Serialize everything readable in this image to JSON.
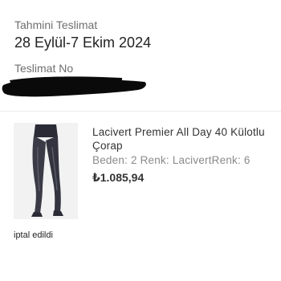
{
  "delivery": {
    "estimated_label": "Tahmini Teslimat",
    "estimated_date": "28 Eylül-7 Ekim 2024",
    "tracking_label": "Teslimat No"
  },
  "product": {
    "image_icon": "pantyhose-product-image",
    "title": "Lacivert Premier All Day 40 Külotlu Çorap",
    "variant": "Beden: 2 Renk: LacivertRenk: 6",
    "price": "₺1.085,94"
  },
  "order": {
    "status": "iptal edildi"
  },
  "colors": {
    "redaction": "#0a0a0a",
    "divider": "#ececec"
  }
}
